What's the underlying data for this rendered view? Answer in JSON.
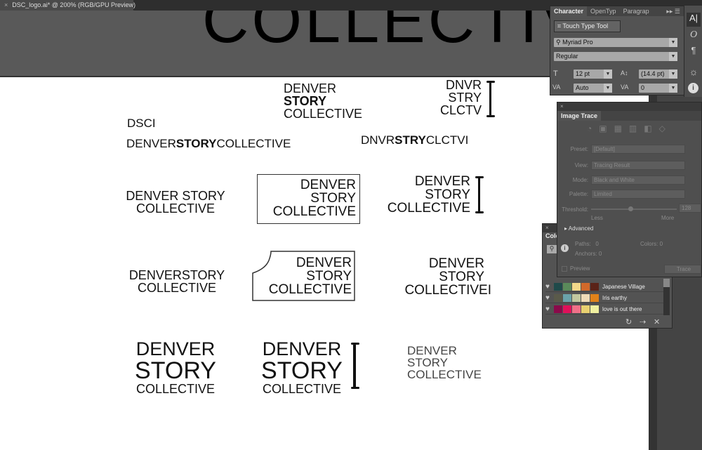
{
  "document_tab": {
    "close": "×",
    "title": "DSC_logo.ai* @ 200% (RGB/GPU Preview)"
  },
  "canvas": {
    "pasteboard_text": "COLLECTIV",
    "logos": [
      {
        "lines": [
          "DENVER",
          "STORY",
          "COLLECTIVE"
        ]
      },
      {
        "lines": [
          "DNVR",
          "STRY",
          "CLCTV"
        ]
      },
      {
        "text": "DSCI"
      },
      {
        "parts": [
          "DENVER",
          "STORY",
          "COLLECTIVE"
        ]
      },
      {
        "parts": [
          "DNVR",
          "STRY",
          "CLCTVI"
        ]
      },
      {
        "lines": [
          "DENVER STORY",
          "COLLECTIVE"
        ]
      },
      {
        "lines": [
          "DENVER",
          "STORY",
          "COLLECTIVE"
        ]
      },
      {
        "lines": [
          "DENVER",
          "STORY",
          "COLLECTIVE"
        ]
      },
      {
        "lines": [
          "DENVERSTORY",
          "COLLECTIVE"
        ]
      },
      {
        "lines": [
          "DENVER",
          "STORY",
          "COLLECTIVE"
        ]
      },
      {
        "lines": [
          "DENVER",
          "STORY",
          "COLLECTIVEI"
        ]
      },
      {
        "lines": [
          "DENVER",
          "STORY",
          "COLLECTIVE"
        ]
      },
      {
        "lines": [
          "DENVER",
          "STORY",
          "COLLECTIVE"
        ]
      },
      {
        "lines": [
          "DENVER",
          "STORY",
          "COLLECTIVE"
        ]
      }
    ]
  },
  "character_panel": {
    "tabs": [
      "Character",
      "OpenTyp",
      "Paragrap"
    ],
    "touch_type_tool": "Touch Type Tool",
    "font_family": "Myriad Pro",
    "font_style": "Regular",
    "font_size": "12 pt",
    "leading": "(14.4 pt)",
    "kerning": "Auto",
    "tracking": "0"
  },
  "dock_icons": [
    "character-icon",
    "opentype-icon",
    "paragraph-icon",
    "symbol-icon",
    "info-icon"
  ],
  "image_trace_panel": {
    "title": "Image Trace",
    "preset_label": "Preset:",
    "preset": "[Default]",
    "view_label": "View:",
    "view": "Tracing Result",
    "mode_label": "Mode:",
    "mode": "Black and White",
    "palette_label": "Palette:",
    "palette": "Limited",
    "threshold_label": "Threshold:",
    "threshold": "128",
    "threshold_fraction": 0.45,
    "less": "Less",
    "more": "More",
    "advanced": "Advanced",
    "paths_label": "Paths:",
    "paths": "0",
    "colors_label": "Colors:",
    "colors": "0",
    "anchors_label": "Anchors:",
    "anchors": "0",
    "preview": "Preview",
    "trace": "Trace"
  },
  "color_panel": {
    "title": "Colo",
    "themes": [
      {
        "name": "Japanese Village",
        "colors": [
          "#1f4a4a",
          "#5a8a5a",
          "#f2d98a",
          "#d2692a",
          "#5a2318"
        ]
      },
      {
        "name": "Iris earthy",
        "colors": [
          "#5a5a4a",
          "#6aa3aa",
          "#c2c8a0",
          "#efdcb8",
          "#e0821a"
        ]
      },
      {
        "name": "love is out there",
        "colors": [
          "#8a0a4a",
          "#e0105a",
          "#f07088",
          "#e8d070",
          "#f0f0a0"
        ]
      }
    ]
  }
}
